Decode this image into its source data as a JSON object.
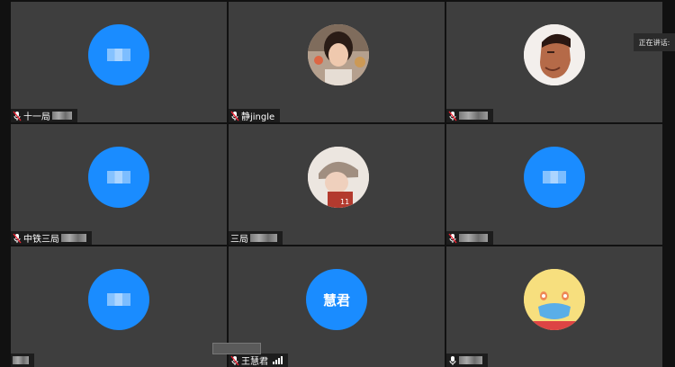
{
  "speaking_indicator": {
    "label": "正在讲话:"
  },
  "colors": {
    "tile_bg": "#3e3e3e",
    "avatar_blue": "#1a8cff",
    "label_bg": "#1d1d1d"
  },
  "tiles": [
    {
      "name_prefix": "十一局",
      "avatar_type": "blue-placeholder",
      "mic": "muted-mic-icon"
    },
    {
      "name_prefix": "静jingle",
      "avatar_type": "photo-woman",
      "mic": "muted-mic-icon"
    },
    {
      "name_prefix": "",
      "avatar_type": "photo-man-portrait",
      "mic": "muted-mic-icon"
    },
    {
      "name_prefix": "中铁三局",
      "avatar_type": "blue-placeholder",
      "mic": "muted-mic-icon"
    },
    {
      "name_prefix": "三局",
      "avatar_type": "photo-child",
      "mic": "none"
    },
    {
      "name_prefix": "",
      "avatar_type": "blue-placeholder",
      "mic": "muted-mic-icon"
    },
    {
      "name_prefix": "",
      "avatar_type": "blue-placeholder",
      "mic": "none"
    },
    {
      "name_prefix": "王慧君",
      "avatar_type": "blue-text",
      "avatar_text": "慧君",
      "mic": "muted-mic-icon",
      "signal": "signal-bars-icon"
    },
    {
      "name_prefix": "",
      "avatar_type": "emoji-mask",
      "mic": "mic-icon"
    }
  ]
}
